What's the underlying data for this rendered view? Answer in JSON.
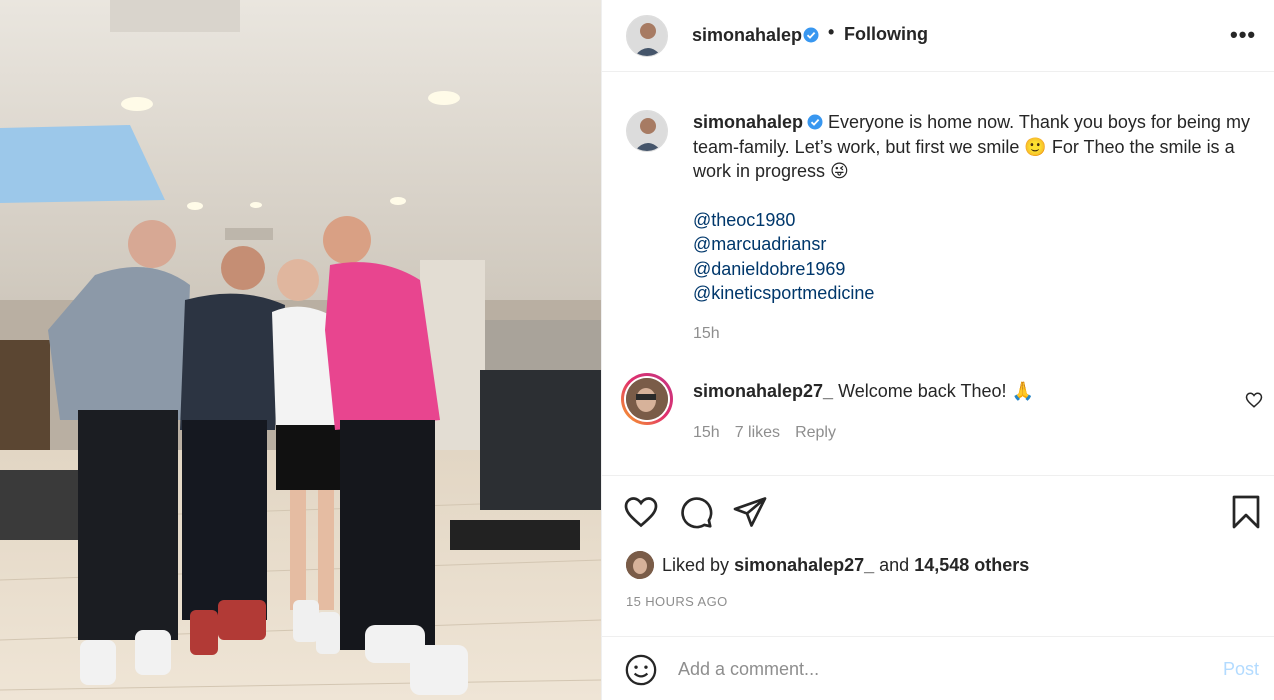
{
  "post": {
    "username": "simonahalep",
    "follow_dot": "•",
    "follow_status": "Following",
    "more_label": "•••"
  },
  "caption": {
    "username": "simonahalep",
    "line1": "Everyone is home now. Thank you boys for being my team-family. Let’s work, but first we smile 🙂 For Theo the smile is a work in progress 😜",
    "mentions": [
      "@theoc1980",
      "@marcuadriansr",
      "@danieldobre1969",
      "@kineticsportmedicine"
    ],
    "time": "15h"
  },
  "comment": {
    "username": "simonahalep27_",
    "text": "Welcome back Theo! 🙏",
    "time": "15h",
    "likes": "7 likes",
    "reply": "Reply"
  },
  "likes": {
    "prefix": "Liked by",
    "user": "simonahalep27_",
    "and": "and",
    "others": "14,548 others"
  },
  "timestamp": "15 HOURS AGO",
  "add_comment": {
    "placeholder": "Add a comment...",
    "post_label": "Post"
  },
  "colors": {
    "verified": "#3897f0",
    "link": "#00376b",
    "muted": "#8e8e8e",
    "post_disabled": "#b3dbff"
  }
}
